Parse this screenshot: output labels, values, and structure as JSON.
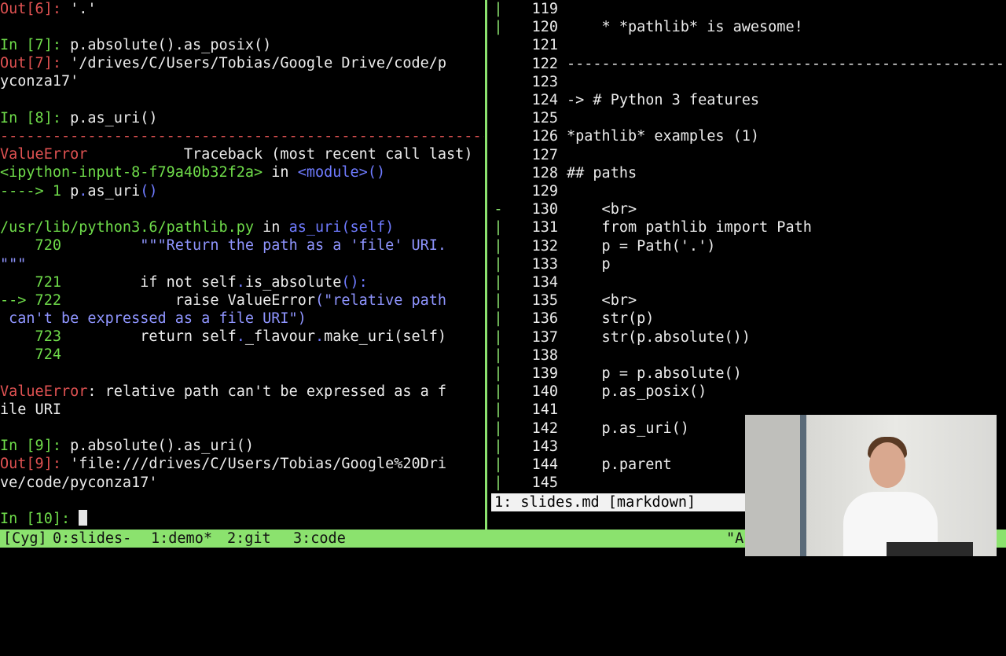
{
  "left_terminal": {
    "lines": [
      [
        {
          "t": "Out[6]: ",
          "c": "red"
        },
        {
          "t": "'.'",
          "c": "white"
        }
      ],
      [],
      [
        {
          "t": "In [7]: ",
          "c": "green"
        },
        {
          "t": "p.absolute().as_posix()",
          "c": "white"
        }
      ],
      [
        {
          "t": "Out[7]: ",
          "c": "red"
        },
        {
          "t": "'/drives/C/Users/Tobias/Google Drive/code/p",
          "c": "white"
        }
      ],
      [
        {
          "t": "yconza17'",
          "c": "white"
        }
      ],
      [],
      [
        {
          "t": "In [8]: ",
          "c": "green"
        },
        {
          "t": "p.as_uri()",
          "c": "white"
        }
      ],
      [
        {
          "t": "---------------------------------------------------------------------------",
          "c": "red"
        }
      ],
      [
        {
          "t": "ValueError",
          "c": "red"
        },
        {
          "t": "           Traceback (most recent call last)",
          "c": "white"
        }
      ],
      [
        {
          "t": "<ipython-input-8-f79a40b32f2a>",
          "c": "green"
        },
        {
          "t": " in ",
          "c": "white"
        },
        {
          "t": "<module>",
          "c": "blue"
        },
        {
          "t": "()",
          "c": "blue"
        }
      ],
      [
        {
          "t": "----> 1 ",
          "c": "green"
        },
        {
          "t": "p",
          "c": "white"
        },
        {
          "t": ".",
          "c": "blue"
        },
        {
          "t": "as_uri",
          "c": "white"
        },
        {
          "t": "()",
          "c": "blue"
        }
      ],
      [],
      [
        {
          "t": "/usr/lib/python3.6/pathlib.py",
          "c": "green"
        },
        {
          "t": " in ",
          "c": "white"
        },
        {
          "t": "as_uri",
          "c": "blue"
        },
        {
          "t": "(self)",
          "c": "blue"
        }
      ],
      [
        {
          "t": "    720 ",
          "c": "green"
        },
        {
          "t": "        ",
          "c": "white"
        },
        {
          "t": "\"\"\"Return the path as a 'file' URI.",
          "c": "blue2"
        }
      ],
      [
        {
          "t": "\"\"\"",
          "c": "blue2"
        }
      ],
      [
        {
          "t": "    721 ",
          "c": "green"
        },
        {
          "t": "        if not self",
          "c": "white"
        },
        {
          "t": ".",
          "c": "blue"
        },
        {
          "t": "is_absolute",
          "c": "white"
        },
        {
          "t": "():",
          "c": "blue"
        }
      ],
      [
        {
          "t": "--> 722 ",
          "c": "green"
        },
        {
          "t": "            raise ",
          "c": "white"
        },
        {
          "t": "ValueError",
          "c": "white"
        },
        {
          "t": "(\"relative path",
          "c": "blue2"
        }
      ],
      [
        {
          "t": " can't be expressed as a file URI\")",
          "c": "blue2"
        }
      ],
      [
        {
          "t": "    723 ",
          "c": "green"
        },
        {
          "t": "        return self",
          "c": "white"
        },
        {
          "t": ".",
          "c": "blue"
        },
        {
          "t": "_flavour",
          "c": "white"
        },
        {
          "t": ".",
          "c": "blue"
        },
        {
          "t": "make_uri",
          "c": "white"
        },
        {
          "t": "(self)",
          "c": "white"
        }
      ],
      [
        {
          "t": "    724 ",
          "c": "green"
        }
      ],
      [],
      [
        {
          "t": "ValueError",
          "c": "red"
        },
        {
          "t": ": relative path can't be expressed as a f",
          "c": "white"
        }
      ],
      [
        {
          "t": "ile URI",
          "c": "white"
        }
      ],
      [],
      [
        {
          "t": "In [9]: ",
          "c": "green"
        },
        {
          "t": "p.absolute().as_uri()",
          "c": "white"
        }
      ],
      [
        {
          "t": "Out[9]: ",
          "c": "red"
        },
        {
          "t": "'file:///drives/C/Users/Tobias/Google%20Dri",
          "c": "white"
        }
      ],
      [
        {
          "t": "ve/code/pyconza17'",
          "c": "white"
        }
      ],
      [],
      [
        {
          "t": "In [10]: ",
          "c": "green"
        }
      ]
    ]
  },
  "editor": {
    "lines": [
      {
        "g": "|",
        "n": "119",
        "t": ""
      },
      {
        "g": "|",
        "n": "120",
        "t": "    * *pathlib* is awesome!"
      },
      {
        "g": "",
        "n": "121",
        "t": ""
      },
      {
        "g": "",
        "n": "122",
        "t": "---------------------------------------------------"
      },
      {
        "g": "",
        "n": "123",
        "t": ""
      },
      {
        "g": "",
        "n": "124",
        "t": "-> # Python 3 features"
      },
      {
        "g": "",
        "n": "125",
        "t": ""
      },
      {
        "g": "",
        "n": "126",
        "t": "*pathlib* examples (1)"
      },
      {
        "g": "",
        "n": "127",
        "t": ""
      },
      {
        "g": "",
        "n": "128",
        "t": "## paths"
      },
      {
        "g": "",
        "n": "129",
        "t": ""
      },
      {
        "g": "-",
        "n": "130",
        "t": "    <br>"
      },
      {
        "g": "|",
        "n": "131",
        "t": "    from pathlib import Path"
      },
      {
        "g": "|",
        "n": "132",
        "t": "    p = Path('.')"
      },
      {
        "g": "|",
        "n": "133",
        "t": "    p"
      },
      {
        "g": "|",
        "n": "134",
        "t": ""
      },
      {
        "g": "|",
        "n": "135",
        "t": "    <br>"
      },
      {
        "g": "|",
        "n": "136",
        "t": "    str(p)"
      },
      {
        "g": "|",
        "n": "137",
        "t": "    str(p.absolute())"
      },
      {
        "g": "|",
        "n": "138",
        "t": ""
      },
      {
        "g": "|",
        "n": "139",
        "t": "    p = p.absolute()"
      },
      {
        "g": "|",
        "n": "140",
        "t": "    p.as_posix()"
      },
      {
        "g": "|",
        "n": "141",
        "t": ""
      },
      {
        "g": "|",
        "n": "142",
        "t": "    p.as_uri()"
      },
      {
        "g": "|",
        "n": "143",
        "t": ""
      },
      {
        "g": "|",
        "n": "144",
        "t": "    p.parent"
      },
      {
        "g": "|",
        "n": "145",
        "t": ""
      }
    ],
    "status": "1: slides.md [markdown]"
  },
  "tmux": {
    "session": "[Cyg]",
    "windows": [
      "0:slides-",
      "1:demo*",
      "2:git",
      "3:code"
    ],
    "right": "\"A"
  },
  "colors": {
    "accent": "#8be26e",
    "prompt_green": "#6fdc4a",
    "error_red": "#e05252",
    "syntax_blue": "#6f7bff"
  }
}
